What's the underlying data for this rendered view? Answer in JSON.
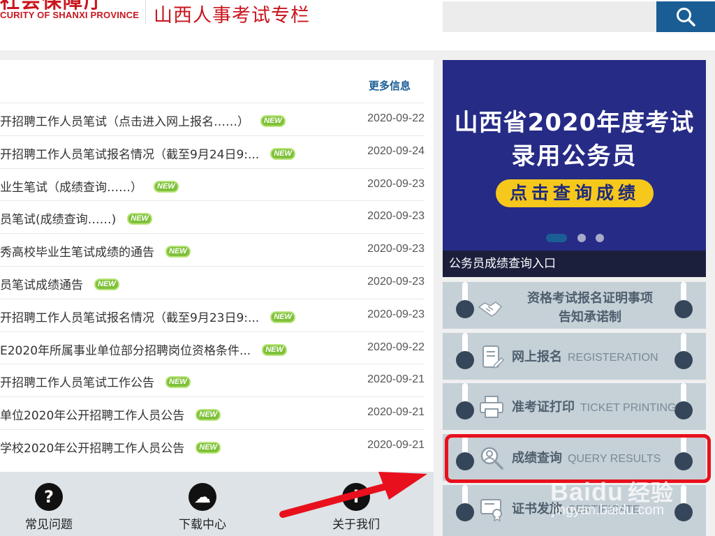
{
  "header": {
    "logo_cn_cut": "社会保障厅",
    "logo_en": "CURITY OF SHANXI PROVINCE",
    "logo_title": "山西人事考试专栏",
    "search_placeholder": ""
  },
  "news": {
    "more_label": "更多信息",
    "new_badge": "NEW",
    "items": [
      {
        "title": "开招聘工作人员笔试（点击进入网上报名……）",
        "date": "2020-09-22"
      },
      {
        "title": "开招聘工作人员笔试报名情况（截至9月24日9:...",
        "date": "2020-09-24"
      },
      {
        "title": "业生笔试（成绩查询……）",
        "date": "2020-09-23"
      },
      {
        "title": "员笔试(成绩查询……)",
        "date": "2020-09-23"
      },
      {
        "title": "秀高校毕业生笔试成绩的通告",
        "date": "2020-09-23"
      },
      {
        "title": "员笔试成绩通告",
        "date": "2020-09-23"
      },
      {
        "title": "开招聘工作人员笔试报名情况（截至9月23日9:...",
        "date": "2020-09-23"
      },
      {
        "title": "E2020年所属事业单位部分招聘岗位资格条件...",
        "date": "2020-09-22"
      },
      {
        "title": "开招聘工作人员笔试工作公告",
        "date": "2020-09-21"
      },
      {
        "title": "单位2020年公开招聘工作人员公告",
        "date": "2020-09-21"
      },
      {
        "title": "学校2020年公开招聘工作人员公告",
        "date": "2020-09-21"
      }
    ]
  },
  "bottom_nav": [
    {
      "label": "常见问题",
      "icon": "?"
    },
    {
      "label": "下载中心",
      "icon": "☁"
    },
    {
      "label": "关于我们",
      "icon": "i"
    }
  ],
  "banner": {
    "line1": "山西省2020年度考试",
    "line2": "录用公务员",
    "button": "点击查询成绩",
    "caption": "公务员成绩查询入口",
    "active_slide": 1,
    "slide_count": 3
  },
  "services": [
    {
      "title": "资格考试报名证明事项",
      "title2": "告知承诺制",
      "en": "",
      "icon": "handshake-icon"
    },
    {
      "title": "网上报名",
      "en": "REGISTERATION",
      "icon": "form-icon"
    },
    {
      "title": "准考证打印",
      "en": "TICKET PRINTING",
      "icon": "printer-icon"
    },
    {
      "title": "成绩查询",
      "en": "QUERY RESULTS",
      "icon": "search-user-icon"
    },
    {
      "title": "证书发放",
      "en": "CERTIFICATE",
      "icon": "certificate-icon"
    }
  ],
  "watermark": {
    "brand": "Baidu",
    "brand_cn": "经验",
    "url": "jingyan.baidu.com"
  },
  "colors": {
    "brand_red": "#c9151e",
    "link_blue": "#1b5e96",
    "banner_bg": "#262b86",
    "banner_button": "#f7c81c",
    "highlight": "#e8101c"
  }
}
